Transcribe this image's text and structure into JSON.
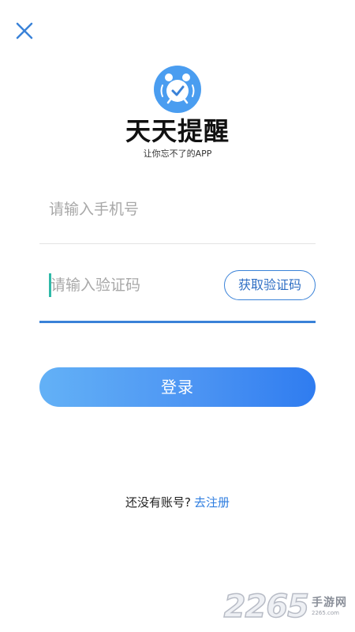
{
  "header": {
    "close_icon": "close-x-icon"
  },
  "brand": {
    "logo_icon": "alarm-clock-check-icon",
    "title": "天天提醒",
    "slogan": "让你忘不了的APP",
    "accent_color": "#3a82d8"
  },
  "form": {
    "phone": {
      "placeholder": "请输入手机号",
      "value": ""
    },
    "code": {
      "placeholder": "请输入验证码",
      "value": ""
    },
    "get_code_label": "获取验证码",
    "login_label": "登录"
  },
  "register": {
    "prompt": "还没有账号?",
    "link": "去注册"
  },
  "watermark": {
    "number": "2265",
    "text_cn": "手游网",
    "text_en": "2265.com"
  }
}
